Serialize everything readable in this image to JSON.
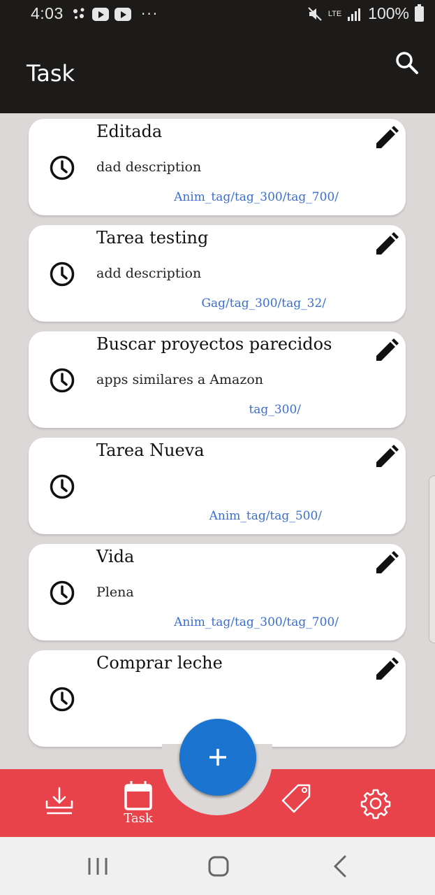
{
  "status_bar": {
    "time": "4:03",
    "network": "LTE",
    "battery": "100%"
  },
  "app_bar": {
    "title": "Task"
  },
  "tasks": [
    {
      "title": "Editada",
      "description": "dad description",
      "tags": "Anim_tag/tag_300/tag_700/"
    },
    {
      "title": "Tarea testing",
      "description": "add description",
      "tags": "Gag/tag_300/tag_32/"
    },
    {
      "title": "Buscar proyectos parecidos",
      "description": "apps similares a Amazon",
      "tags": "tag_300/"
    },
    {
      "title": "Tarea Nueva",
      "description": "",
      "tags": "Anim_tag/tag_500/"
    },
    {
      "title": "Vida",
      "description": "Plena",
      "tags": "Anim_tag/tag_300/tag_700/"
    },
    {
      "title": "Comprar leche",
      "description": "",
      "tags": ""
    }
  ],
  "bottom_nav": {
    "items": [
      {
        "icon": "download-tray-icon",
        "label": ""
      },
      {
        "icon": "calendar-icon",
        "label": "Task"
      },
      {
        "icon": "tag-icon",
        "label": ""
      },
      {
        "icon": "gear-icon",
        "label": ""
      }
    ],
    "fab_icon": "plus-icon"
  },
  "colors": {
    "app_bar": "#1c1b1a",
    "bottom_nav": "#e8434a",
    "fab": "#1b75d0",
    "tag_text": "#3a6fcf",
    "background": "#dcd8d8"
  }
}
